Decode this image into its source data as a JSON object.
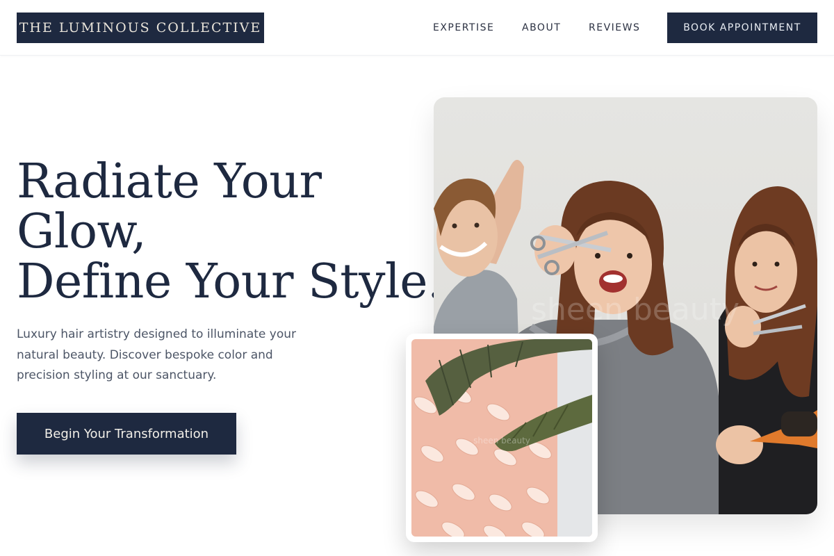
{
  "header": {
    "logo": "THE LUMINOUS COLLECTIVE",
    "nav": [
      "EXPERTISE",
      "ABOUT",
      "REVIEWS"
    ],
    "book_button": "BOOK APPOINTMENT"
  },
  "hero": {
    "headline_line1": "Radiate Your",
    "headline_line2": "Glow,",
    "headline_line3": "Define Your Style.",
    "description": "Luxury hair artistry designed to illuminate your natural beauty. Discover bespoke color and precision styling at our sanctuary.",
    "cta": "Begin Your Transformation"
  },
  "images": {
    "main_watermark": "sheen beauty",
    "secondary_watermark": "sheen beauty"
  },
  "colors": {
    "navy": "#1e2940",
    "cream": "#e9e4da",
    "body_text": "#4c5566",
    "blush": "#efb9a6"
  }
}
